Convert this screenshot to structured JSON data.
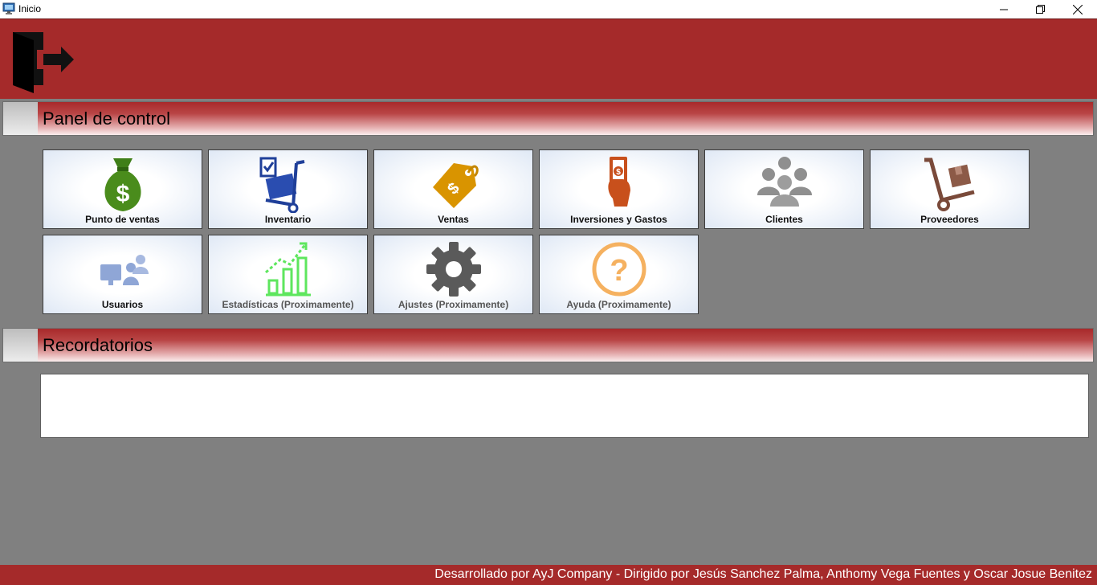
{
  "window": {
    "title": "Inicio"
  },
  "panel": {
    "title": "Panel de control"
  },
  "tiles": [
    {
      "label": "Punto de ventas",
      "icon": "money-bag-icon"
    },
    {
      "label": "Inventario",
      "icon": "inventory-cart-icon"
    },
    {
      "label": "Ventas",
      "icon": "price-tag-icon"
    },
    {
      "label": "Inversiones y Gastos",
      "icon": "hand-money-icon"
    },
    {
      "label": "Clientes",
      "icon": "people-group-icon"
    },
    {
      "label": "Proveedores",
      "icon": "hand-truck-icon"
    },
    {
      "label": "Usuarios",
      "icon": "users-computer-icon"
    },
    {
      "label": "Estadísticas (Proximamente)",
      "icon": "growth-chart-icon"
    },
    {
      "label": "Ajustes (Proximamente)",
      "icon": "gear-icon"
    },
    {
      "label": "Ayuda (Proximamente)",
      "icon": "question-icon"
    }
  ],
  "reminders": {
    "title": "Recordatorios"
  },
  "footer": {
    "text": "Desarrollado por AyJ Company - Dirigido por Jesús Sanchez Palma, Anthomy Vega Fuentes y Oscar Josue Benitez"
  },
  "colors": {
    "header": "#a52a2a",
    "background": "#808080",
    "tile": "#dfe8f5"
  }
}
